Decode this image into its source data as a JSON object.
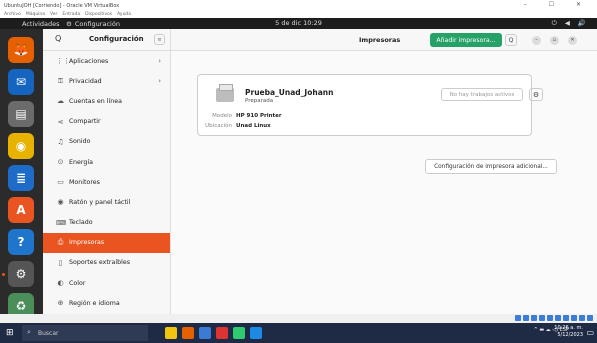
{
  "vbox": {
    "title": "UbuntuJOH [Corriendo] - Oracle VM VirtualBox",
    "menu": [
      "Archivo",
      "Máquina",
      "Ver",
      "Entrada",
      "Dispositivos",
      "Ayuda"
    ],
    "controls": "–  ☐  ✕"
  },
  "topbar": {
    "activities": "Actividades",
    "app": "Configuración",
    "clock": "5 de dic  10:29",
    "tray": "⏻ ◀ 🔊"
  },
  "dock": [
    {
      "name": "firefox",
      "color": "#e66000",
      "glyph": "🦊"
    },
    {
      "name": "thunderbird",
      "color": "#1565c0",
      "glyph": "✉"
    },
    {
      "name": "files",
      "color": "#6b6b6b",
      "glyph": "▤"
    },
    {
      "name": "rhythmbox",
      "color": "#e8b200",
      "glyph": "◉"
    },
    {
      "name": "writer",
      "color": "#1e6cc7",
      "glyph": "≣"
    },
    {
      "name": "software",
      "color": "#e95420",
      "glyph": "A"
    },
    {
      "name": "help",
      "color": "#1f75cb",
      "glyph": "?"
    },
    {
      "name": "settings",
      "color": "#555",
      "glyph": "⚙"
    },
    {
      "name": "trash",
      "color": "#4a8f5a",
      "glyph": "♻"
    }
  ],
  "sidebar": {
    "search_icon": "Q",
    "title": "Configuración",
    "menu_icon": "≡",
    "items": [
      {
        "icon": "⋮⋮",
        "label": "Aplicaciones",
        "chevron": "›"
      },
      {
        "icon": "⚿",
        "label": "Privacidad",
        "chevron": "›"
      },
      {
        "icon": "☁",
        "label": "Cuentas en línea",
        "chevron": ""
      },
      {
        "icon": "⋖",
        "label": "Compartir",
        "chevron": ""
      },
      {
        "icon": "♫",
        "label": "Sonido",
        "chevron": ""
      },
      {
        "icon": "⊙",
        "label": "Energía",
        "chevron": ""
      },
      {
        "icon": "▭",
        "label": "Monitores",
        "chevron": ""
      },
      {
        "icon": "◉",
        "label": "Ratón y panel táctil",
        "chevron": ""
      },
      {
        "icon": "⌨",
        "label": "Teclado",
        "chevron": ""
      },
      {
        "icon": "⎙",
        "label": "Impresoras",
        "chevron": ""
      },
      {
        "icon": "▯",
        "label": "Soportes extraíbles",
        "chevron": ""
      },
      {
        "icon": "◐",
        "label": "Color",
        "chevron": ""
      },
      {
        "icon": "⊕",
        "label": "Región e idioma",
        "chevron": ""
      }
    ],
    "active_index": 9
  },
  "main": {
    "title": "Impresoras",
    "add_label": "Añadir impresora...",
    "search_icon": "Q",
    "min": "–",
    "max": "▫",
    "close": "✕",
    "printer": {
      "name": "Prueba_Unad_Johann",
      "state": "Preparada",
      "model_key": "Modelo",
      "model": "HP 910 Printer",
      "location_key": "Ubicación",
      "location": "Unad Linux",
      "jobs_label": "No hay trabajos activos",
      "gear_icon": "⚙"
    },
    "config_label": "Configuración de impresora adicional..."
  },
  "taskbar": {
    "search_placeholder": "Buscar",
    "clock_time": "10:26 a. m.",
    "clock_date": "5/12/2023",
    "lang": "ESP",
    "tray": "^  ▬  ☁  ◁)"
  }
}
